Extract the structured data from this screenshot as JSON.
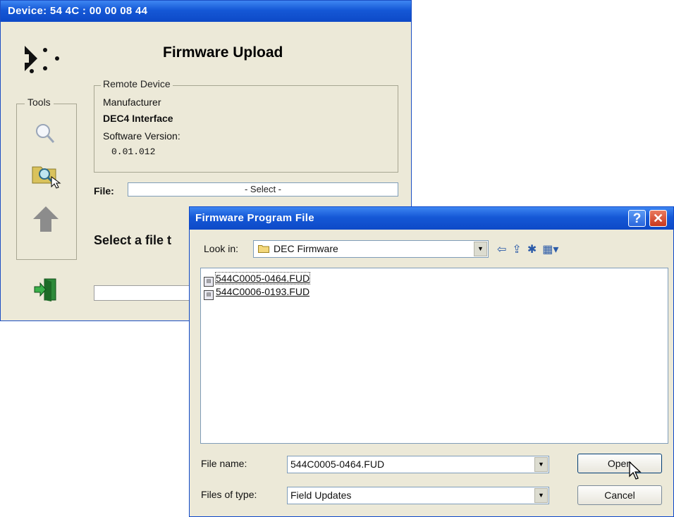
{
  "main_window": {
    "title": "Device:  54 4C : 00 00 08 44",
    "app_title": "Firmware Upload",
    "tools_label": "Tools",
    "remote_device": {
      "group_label": "Remote Device",
      "manufacturer_label": "Manufacturer",
      "manufacturer_value": "DEC4 Interface",
      "software_version_label": "Software Version:",
      "software_version_value": "0.01.012"
    },
    "file_label": "File:",
    "file_value": "- Select -",
    "status_message": "Select a file t"
  },
  "dialog": {
    "title": "Firmware Program File",
    "help_label": "?",
    "close_label": "✕",
    "look_in_label": "Look in:",
    "look_in_value": "DEC Firmware",
    "files": [
      {
        "name": "544C0005-0464.FUD",
        "selected": true
      },
      {
        "name": "544C0006-0193.FUD",
        "selected": false
      }
    ],
    "file_name_label": "File name:",
    "file_name_value": "544C0005-0464.FUD",
    "files_of_type_label": "Files of type:",
    "files_of_type_value": "Field Updates",
    "open_label": "Open",
    "cancel_label": "Cancel"
  },
  "icons": {
    "logo": "device-logo-icon",
    "search": "magnifier-icon",
    "browse": "folder-search-icon",
    "upload": "up-arrow-icon",
    "exit": "exit-door-icon",
    "folder": "folder-icon",
    "back": "back-arrow-icon",
    "up_folder": "up-folder-icon",
    "new_folder": "new-folder-icon",
    "view_menu": "view-menu-icon"
  },
  "colors": {
    "titlebar": "#0d49c7",
    "window_bg": "#ece9d8",
    "close_button": "#c8371e"
  }
}
